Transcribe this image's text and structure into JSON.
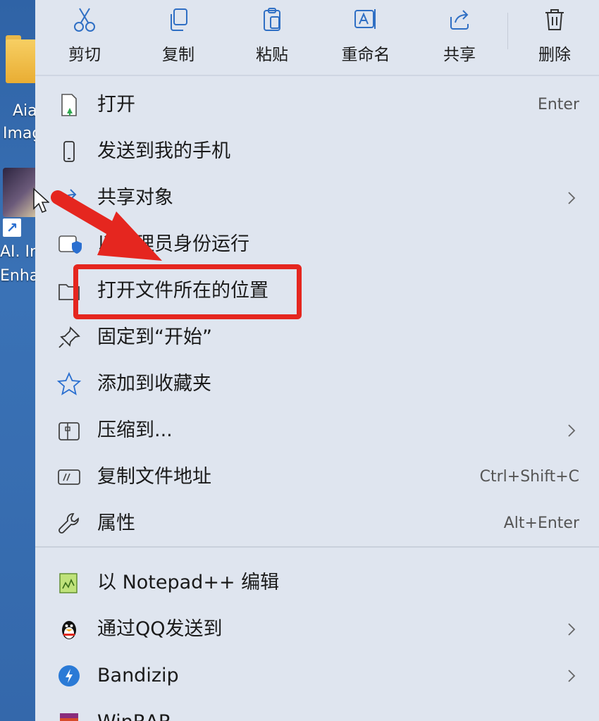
{
  "desktop": {
    "icon1_label_line1": "Aia",
    "icon1_label_line2": "Imag",
    "icon2_label_line1": "AI. Ir",
    "icon2_label_line2": "Enha"
  },
  "toolbar": {
    "cut": "剪切",
    "copy": "复制",
    "paste": "粘贴",
    "rename": "重命名",
    "share": "共享",
    "delete": "删除"
  },
  "menu": {
    "items": [
      {
        "label": "打开",
        "shortcut": "Enter"
      },
      {
        "label": "发送到我的手机",
        "shortcut": ""
      },
      {
        "label": "共享对象",
        "shortcut": ""
      },
      {
        "label": "以管理员身份运行",
        "shortcut": ""
      },
      {
        "label": "打开文件所在的位置",
        "shortcut": ""
      },
      {
        "label": "固定到“开始”",
        "shortcut": ""
      },
      {
        "label": "添加到收藏夹",
        "shortcut": ""
      },
      {
        "label": "压缩到...",
        "shortcut": ""
      },
      {
        "label": "复制文件地址",
        "shortcut": "Ctrl+Shift+C"
      },
      {
        "label": "属性",
        "shortcut": "Alt+Enter"
      },
      {
        "label": "以 Notepad++ 编辑",
        "shortcut": ""
      },
      {
        "label": "通过QQ发送到",
        "shortcut": ""
      },
      {
        "label": "Bandizip",
        "shortcut": ""
      },
      {
        "label": "WinRAR",
        "shortcut": ""
      }
    ]
  },
  "colors": {
    "menu_bg": "#dfe5ef",
    "highlight": "#e5261f",
    "accent_blue": "#2a6fd0"
  }
}
